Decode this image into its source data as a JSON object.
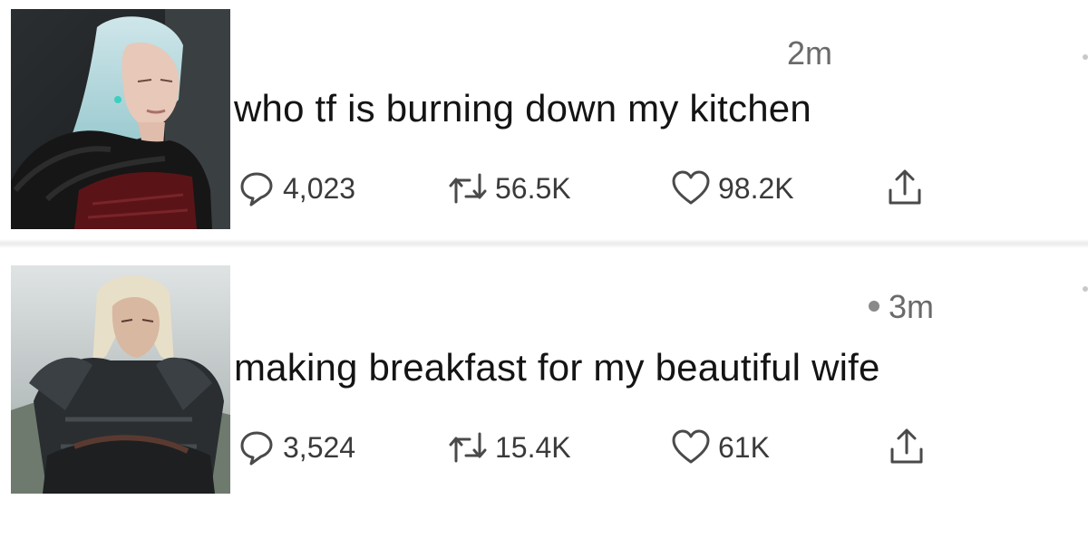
{
  "tweets": [
    {
      "time": "2m",
      "text": "who tf is burning down my kitchen",
      "replies": "4,023",
      "retweets": "56.5K",
      "likes": "98.2K",
      "avatar_icon": "avatar-silver-haired-woman-fur-cloak"
    },
    {
      "time": "3m",
      "text": "making breakfast for my beautiful wife",
      "replies": "3,524",
      "retweets": "15.4K",
      "likes": "61K",
      "avatar_icon": "avatar-silver-haired-man-armor"
    }
  ],
  "icons": {
    "reply": "reply-icon",
    "retweet": "retweet-icon",
    "like": "heart-icon",
    "share": "share-icon"
  },
  "colors": {
    "text": "#141414",
    "meta": "#6a6a6a",
    "icon": "#4a4a4a"
  }
}
